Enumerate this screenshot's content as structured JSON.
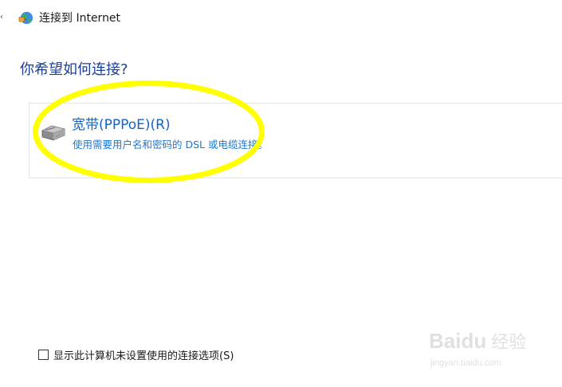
{
  "window": {
    "title": "连接到 Internet",
    "back_glyph": "‹",
    "icon": "network-globe-icon"
  },
  "main": {
    "heading": "你希望如何连接?",
    "options": [
      {
        "title": "宽带(PPPoE)(R)",
        "description": "使用需要用户名和密码的 DSL 或电缆连接。",
        "icon": "broadband-modem-icon"
      }
    ]
  },
  "footer": {
    "checkbox_label": "显示此计算机未设置使用的连接选项(S)",
    "checked": false
  },
  "annotation": {
    "highlight_color": "#ffff00",
    "shape": "ellipse"
  },
  "watermark": {
    "brand": "Baidu",
    "cn": "经验",
    "url": "jingyan.baidu.com"
  },
  "colors": {
    "heading": "#1c3f94",
    "link": "#1065c8",
    "card_border": "#dde6ee"
  }
}
